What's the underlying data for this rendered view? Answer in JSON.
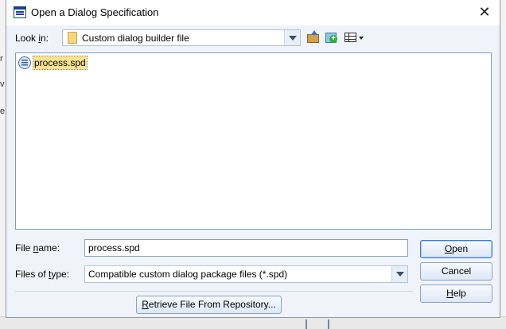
{
  "dialog": {
    "title": "Open a Dialog Specification",
    "close_glyph": "✕"
  },
  "lookin": {
    "label_prefix": "Look ",
    "label_accel": "i",
    "label_suffix": "n:",
    "value": "Custom dialog builder file"
  },
  "files": [
    {
      "name": "process.spd",
      "icon": "spd-file-icon"
    }
  ],
  "filename": {
    "label_prefix": "File ",
    "label_accel": "n",
    "label_suffix": "ame:",
    "value": "process.spd"
  },
  "filetype": {
    "label_prefix": "Files of ",
    "label_accel": "t",
    "label_suffix": "ype:",
    "value": "Compatible custom dialog package files (*.spd)"
  },
  "buttons": {
    "open_accel": "O",
    "open_rest": "pen",
    "cancel": "Cancel",
    "help_accel": "H",
    "help_rest": "elp",
    "retrieve_accel": "R",
    "retrieve_rest": "etrieve File From Repository..."
  },
  "background": {
    "frag1": "r",
    "frag2": "v",
    "frag3": "e"
  },
  "colors": {
    "dialog_bg": "#f0f4fa",
    "selection": "#fbe28f",
    "accent": "#3c78d8"
  }
}
